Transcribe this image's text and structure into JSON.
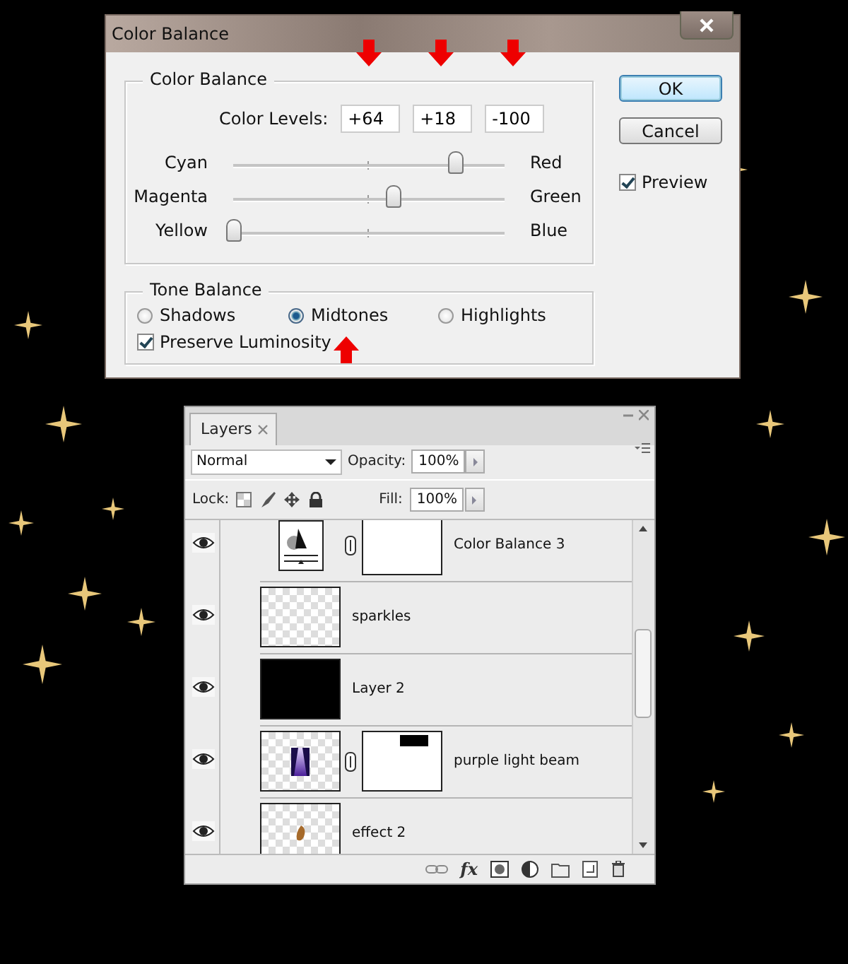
{
  "dialog": {
    "title": "Color Balance",
    "color_balance": {
      "legend": "Color Balance",
      "levels_label": "Color Levels:",
      "levels": [
        {
          "value": "+64",
          "marked": true
        },
        {
          "value": "+18",
          "marked": true
        },
        {
          "value": "-100",
          "marked": true
        }
      ],
      "sliders": [
        {
          "left": "Cyan",
          "right": "Red",
          "level": 0.82
        },
        {
          "left": "Magenta",
          "right": "Green",
          "level": 0.59
        },
        {
          "left": "Yellow",
          "right": "Blue",
          "level": 0
        }
      ]
    },
    "tone_balance": {
      "legend": "Tone Balance",
      "options": [
        {
          "label": "Shadows",
          "selected": false
        },
        {
          "label": "Midtones",
          "selected": true,
          "marked": true
        },
        {
          "label": "Highlights",
          "selected": false
        }
      ],
      "preserve_luminosity": {
        "label": "Preserve Luminosity",
        "checked": true
      }
    },
    "buttons": [
      {
        "label": "OK",
        "default": true
      },
      {
        "label": "Cancel",
        "default": false
      }
    ],
    "preview": {
      "label": "Preview",
      "checked": true
    }
  },
  "layers_panel": {
    "tab": "Layers",
    "blend_mode": "Normal",
    "opacity_label": "Opacity:",
    "opacity": "100%",
    "lock_label": "Lock:",
    "fill_label": "Fill:",
    "fill": "100%",
    "layers": [
      {
        "name": "Color Balance 3",
        "visible": true,
        "kind": "adjustment",
        "mask": {
          "kind": "plain"
        }
      },
      {
        "name": "sparkles",
        "visible": true,
        "kind": "transparent"
      },
      {
        "name": "Layer 2",
        "visible": true,
        "kind": "black"
      },
      {
        "name": "purple light beam",
        "visible": true,
        "kind": "beam",
        "mask": {
          "kind": "bar"
        }
      },
      {
        "name": "effect 2",
        "visible": true,
        "kind": "blob"
      }
    ],
    "fx_label": "fx"
  }
}
